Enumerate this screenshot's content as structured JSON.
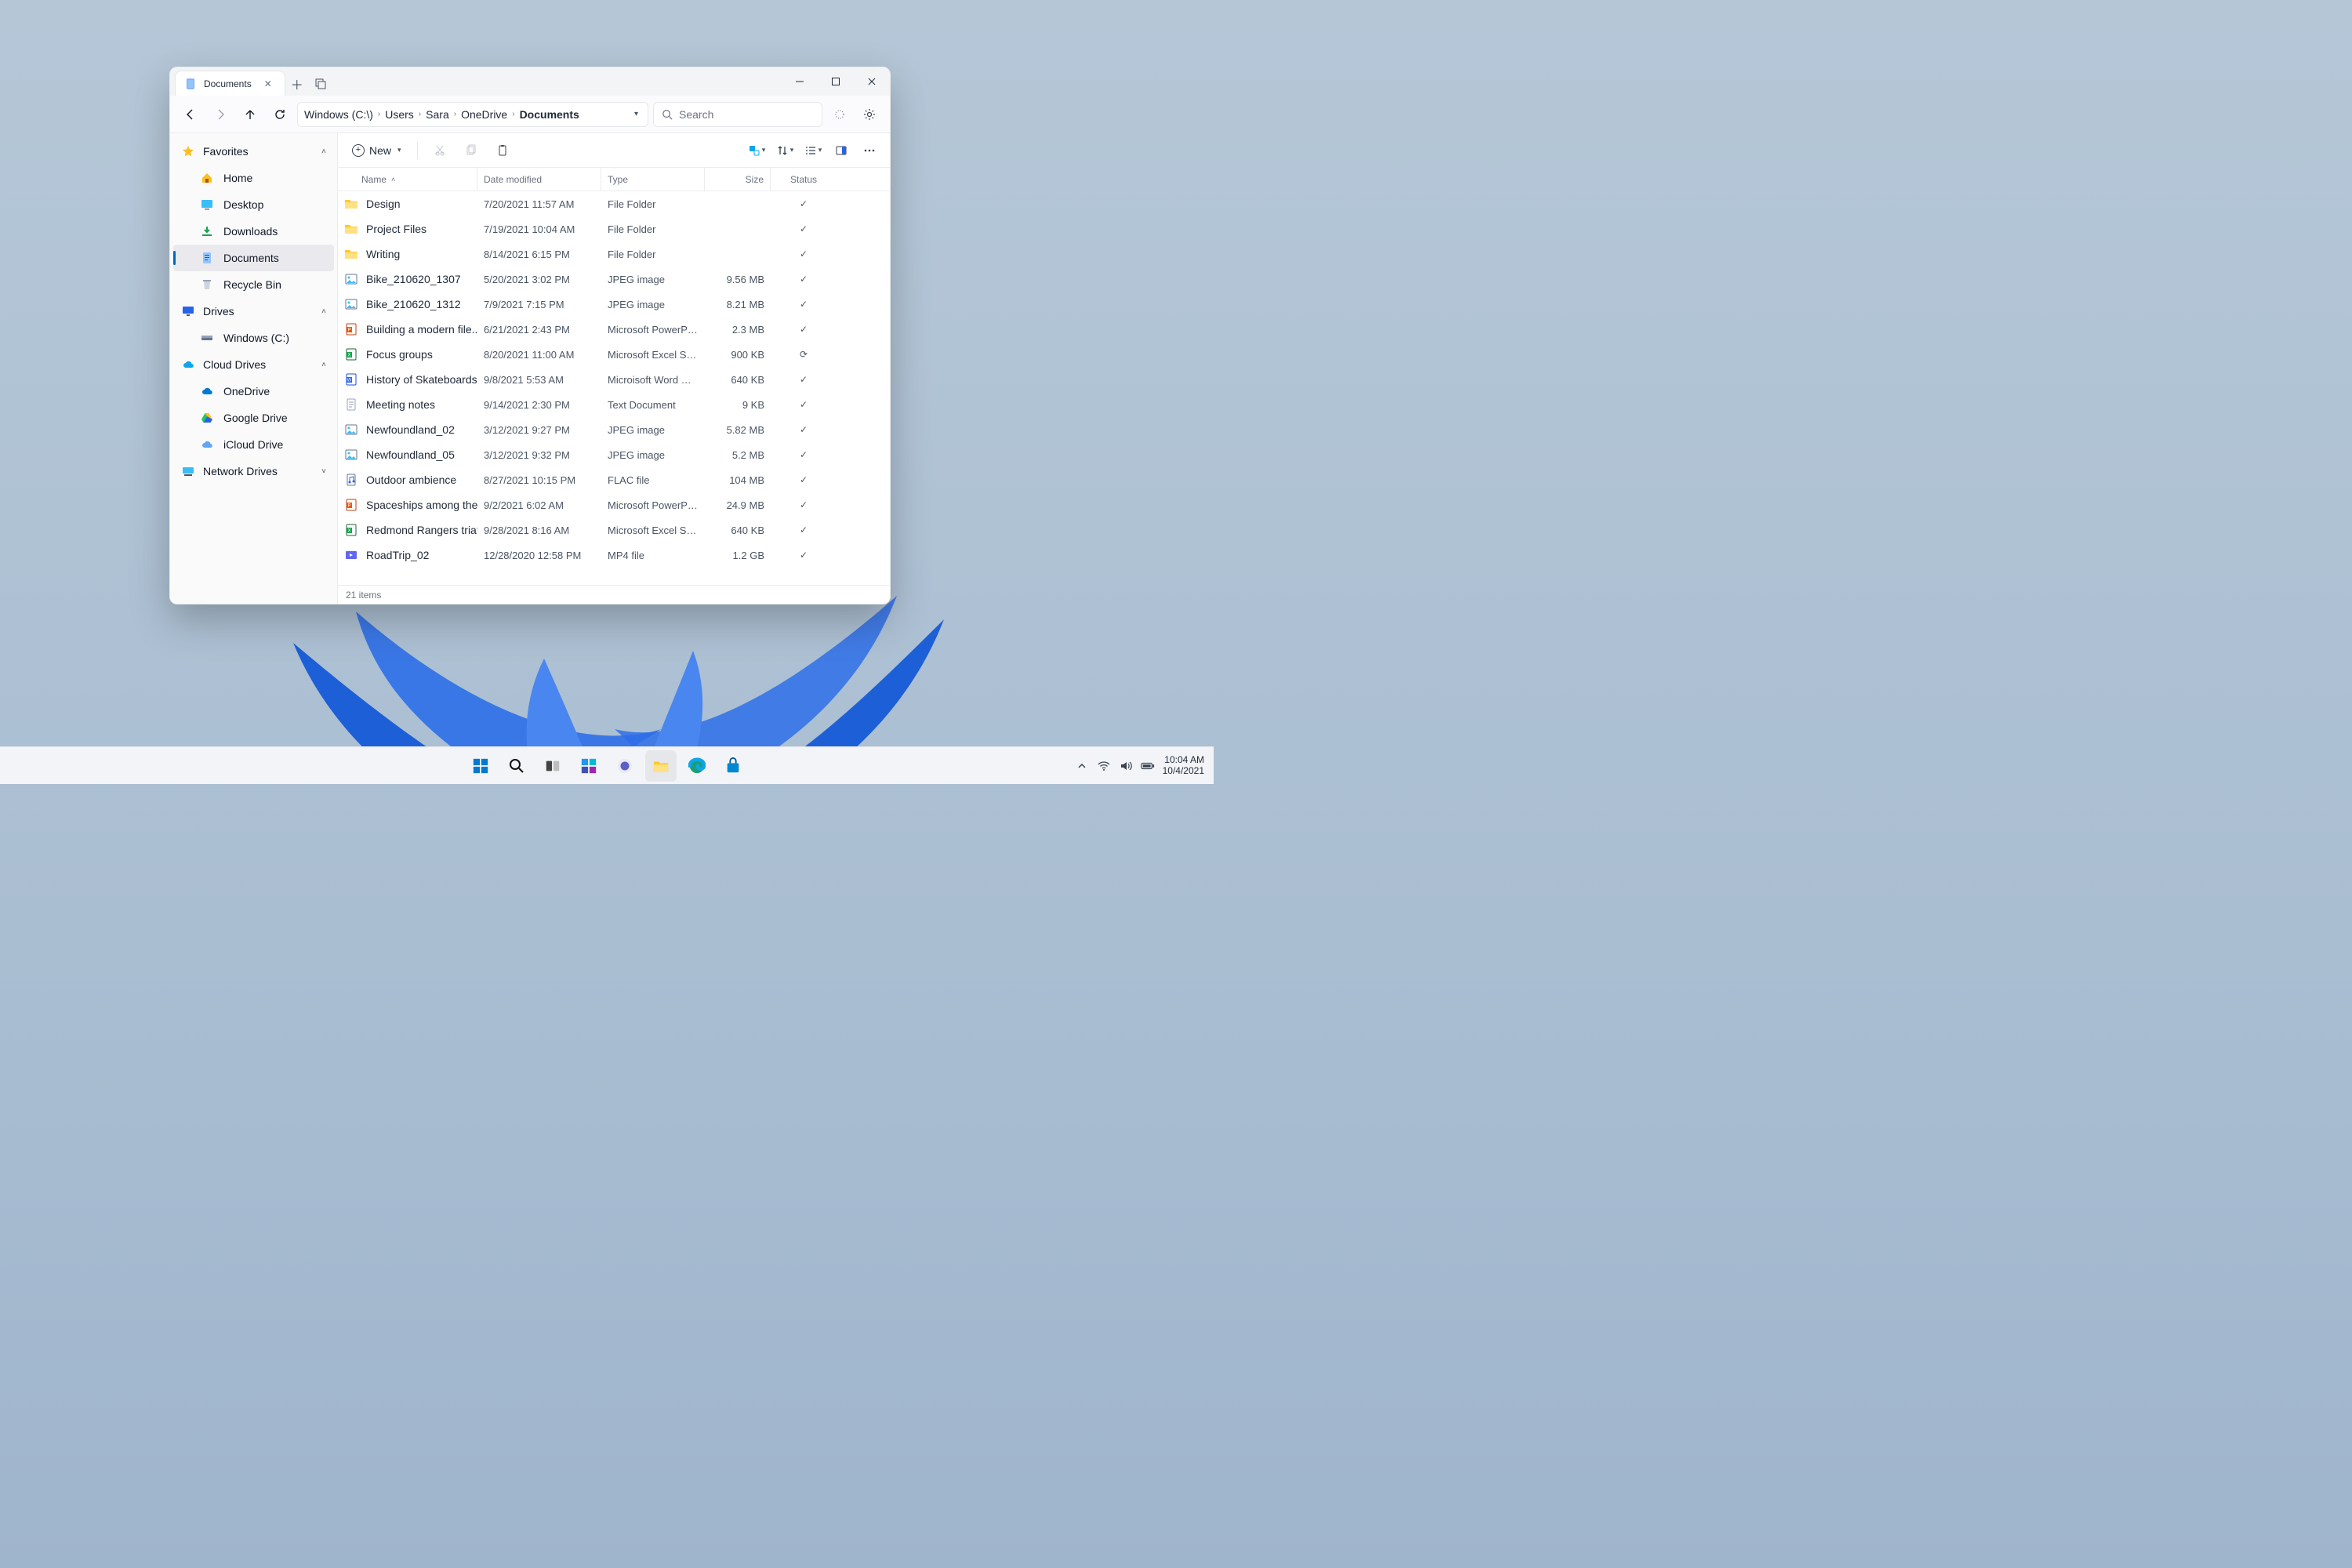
{
  "window": {
    "tab_title": "Documents",
    "search_placeholder": "Search",
    "new_label": "New",
    "status_text": "21 items"
  },
  "breadcrumbs": [
    "Windows (C:\\)",
    "Users",
    "Sara",
    "OneDrive",
    "Documents"
  ],
  "columns": {
    "name": "Name",
    "date": "Date modified",
    "type": "Type",
    "size": "Size",
    "status": "Status"
  },
  "sidebar": {
    "sections": [
      {
        "label": "Favorites",
        "expanded": true,
        "icon": "star",
        "items": [
          {
            "label": "Home",
            "icon": "home"
          },
          {
            "label": "Desktop",
            "icon": "desktop"
          },
          {
            "label": "Downloads",
            "icon": "download"
          },
          {
            "label": "Documents",
            "icon": "doc",
            "selected": true
          },
          {
            "label": "Recycle Bin",
            "icon": "trash"
          }
        ]
      },
      {
        "label": "Drives",
        "expanded": true,
        "icon": "monitor",
        "items": [
          {
            "label": "Windows (C:)",
            "icon": "disk"
          }
        ]
      },
      {
        "label": "Cloud Drives",
        "expanded": true,
        "icon": "cloud",
        "items": [
          {
            "label": "OneDrive",
            "icon": "cloud-blue"
          },
          {
            "label": "Google Drive",
            "icon": "gdrive"
          },
          {
            "label": "iCloud Drive",
            "icon": "icloud"
          }
        ]
      },
      {
        "label": "Network Drives",
        "expanded": false,
        "icon": "network",
        "items": []
      }
    ]
  },
  "files": [
    {
      "name": "Design",
      "date": "7/20/2021  11:57 AM",
      "type": "File Folder",
      "size": "",
      "status": "check",
      "icon": "folder"
    },
    {
      "name": "Project Files",
      "date": "7/19/2021  10:04 AM",
      "type": "File Folder",
      "size": "",
      "status": "check",
      "icon": "folder"
    },
    {
      "name": "Writing",
      "date": "8/14/2021  6:15 PM",
      "type": "File Folder",
      "size": "",
      "status": "check",
      "icon": "folder"
    },
    {
      "name": "Bike_210620_1307",
      "date": "5/20/2021  3:02 PM",
      "type": "JPEG image",
      "size": "9.56 MB",
      "status": "check",
      "icon": "image"
    },
    {
      "name": "Bike_210620_1312",
      "date": "7/9/2021  7:15 PM",
      "type": "JPEG image",
      "size": "8.21 MB",
      "status": "check",
      "icon": "image"
    },
    {
      "name": "Building a modern file...",
      "date": "6/21/2021  2:43 PM",
      "type": "Microsoft PowerPoint...",
      "size": "2.3 MB",
      "status": "check",
      "icon": "ppt"
    },
    {
      "name": "Focus groups",
      "date": "8/20/2021  11:00 AM",
      "type": "Microsoft Excel Sprea...",
      "size": "900 KB",
      "status": "sync",
      "icon": "xls"
    },
    {
      "name": "History of Skateboards",
      "date": "9/8/2021  5:53 AM",
      "type": "Microisoft Word Doc...",
      "size": "640 KB",
      "status": "check",
      "icon": "doc"
    },
    {
      "name": "Meeting notes",
      "date": "9/14/2021  2:30 PM",
      "type": "Text Document",
      "size": "9 KB",
      "status": "check",
      "icon": "text"
    },
    {
      "name": "Newfoundland_02",
      "date": "3/12/2021  9:27 PM",
      "type": "JPEG image",
      "size": "5.82 MB",
      "status": "check",
      "icon": "image"
    },
    {
      "name": "Newfoundland_05",
      "date": "3/12/2021  9:32 PM",
      "type": "JPEG image",
      "size": "5.2 MB",
      "status": "check",
      "icon": "image"
    },
    {
      "name": "Outdoor ambience",
      "date": "8/27/2021  10:15 PM",
      "type": "FLAC file",
      "size": "104 MB",
      "status": "check",
      "icon": "audio"
    },
    {
      "name": "Spaceships among the...",
      "date": "9/2/2021  6:02 AM",
      "type": "Microsoft PowerPoint...",
      "size": "24.9 MB",
      "status": "check",
      "icon": "ppt"
    },
    {
      "name": "Redmond Rangers triat...",
      "date": "9/28/2021  8:16 AM",
      "type": "Microsoft Excel Sprea...",
      "size": "640 KB",
      "status": "check",
      "icon": "xls"
    },
    {
      "name": "RoadTrip_02",
      "date": "12/28/2020  12:58 PM",
      "type": "MP4 file",
      "size": "1.2 GB",
      "status": "check",
      "icon": "video"
    }
  ],
  "taskbar": {
    "time": "10:04 AM",
    "date": "10/4/2021"
  }
}
